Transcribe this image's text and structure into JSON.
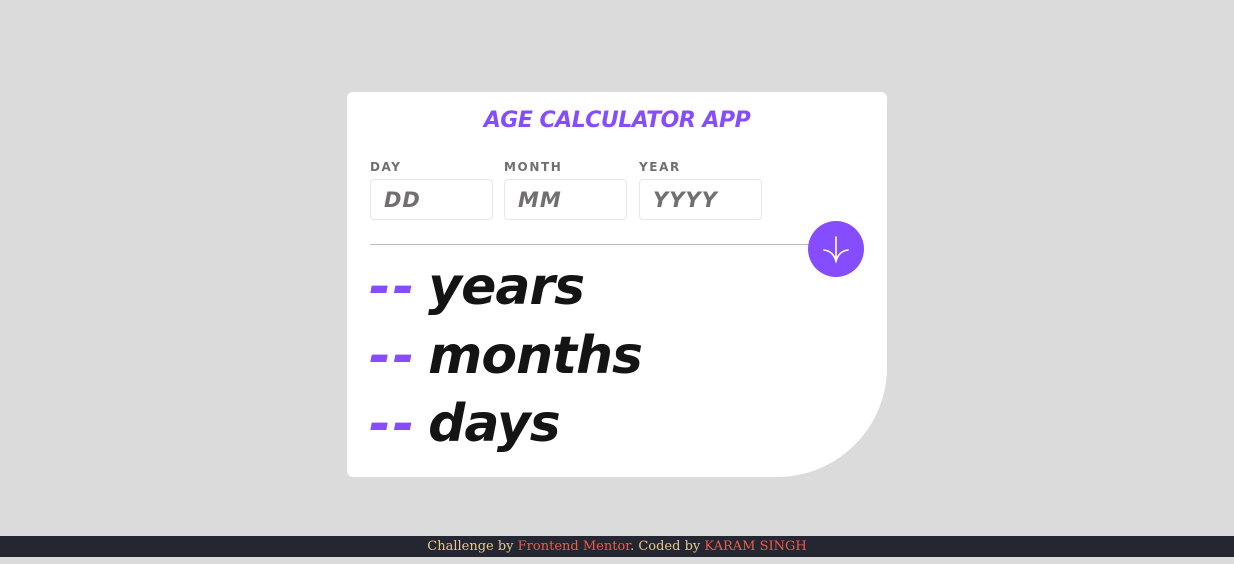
{
  "app": {
    "title": "AGE CALCULATOR APP"
  },
  "form": {
    "day": {
      "label": "DAY",
      "placeholder": "DD",
      "value": ""
    },
    "month": {
      "label": "MONTH",
      "placeholder": "MM",
      "value": ""
    },
    "year": {
      "label": "YEAR",
      "placeholder": "YYYY",
      "value": ""
    },
    "submit_icon": "arrow-down-icon"
  },
  "results": {
    "years": {
      "value": "--",
      "unit": "years"
    },
    "months": {
      "value": "--",
      "unit": "months"
    },
    "days": {
      "value": "--",
      "unit": "days"
    }
  },
  "footer": {
    "challenge_prefix": "Challenge by",
    "challenge_link": "Frontend Mentor",
    "coded_prefix": ". Coded by",
    "author_link": "KARAM SINGH"
  },
  "colors": {
    "accent": "#854dff",
    "background": "#dbdbdb",
    "card": "#ffffff",
    "text": "#141414",
    "label": "#716f6f",
    "footer_bg": "#242631",
    "footer_text": "#e8c88f",
    "footer_link": "#f2594e"
  }
}
